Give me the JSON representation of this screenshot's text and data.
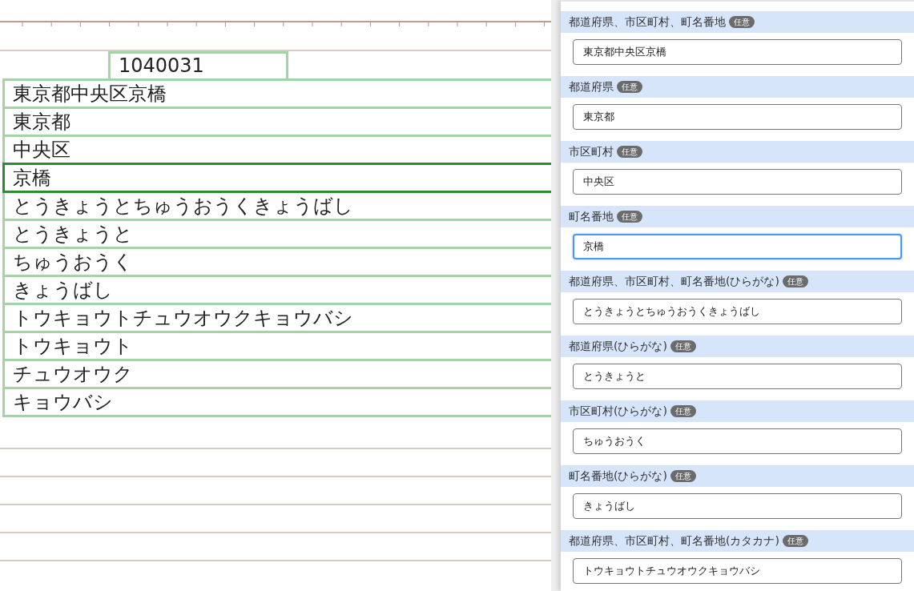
{
  "postal_code": "1040031",
  "canvas_rows": [
    {
      "text": "東京都中央区京橋",
      "selected": false
    },
    {
      "text": "東京都",
      "selected": false
    },
    {
      "text": "中央区",
      "selected": false
    },
    {
      "text": "京橋",
      "selected": true
    },
    {
      "text": "とうきょうとちゅうおうくきょうばし",
      "selected": false
    },
    {
      "text": "とうきょうと",
      "selected": false
    },
    {
      "text": "ちゅうおうく",
      "selected": false
    },
    {
      "text": "きょうばし",
      "selected": false
    },
    {
      "text": "トウキョウトチュウオウクキョウバシ",
      "selected": false
    },
    {
      "text": "トウキョウト",
      "selected": false
    },
    {
      "text": "チュウオウク",
      "selected": false
    },
    {
      "text": "キョウバシ",
      "selected": false
    }
  ],
  "fields": [
    {
      "label": "都道府県、市区町村、町名番地",
      "badge": "任意",
      "value": "東京都中央区京橋",
      "focused": false
    },
    {
      "label": "都道府県",
      "badge": "任意",
      "value": "東京都",
      "focused": false
    },
    {
      "label": "市区町村",
      "badge": "任意",
      "value": "中央区",
      "focused": false
    },
    {
      "label": "町名番地",
      "badge": "任意",
      "value": "京橋",
      "focused": true
    },
    {
      "label": "都道府県、市区町村、町名番地(ひらがな)",
      "badge": "任意",
      "value": "とうきょうとちゅうおうくきょうばし",
      "focused": false
    },
    {
      "label": "都道府県(ひらがな)",
      "badge": "任意",
      "value": "とうきょうと",
      "focused": false
    },
    {
      "label": "市区町村(ひらがな)",
      "badge": "任意",
      "value": "ちゅうおうく",
      "focused": false
    },
    {
      "label": "町名番地(ひらがな)",
      "badge": "任意",
      "value": "きょうばし",
      "focused": false
    },
    {
      "label": "都道府県、市区町村、町名番地(カタカナ)",
      "badge": "任意",
      "value": "トウキョウトチュウオウクキョウバシ",
      "focused": false
    }
  ]
}
